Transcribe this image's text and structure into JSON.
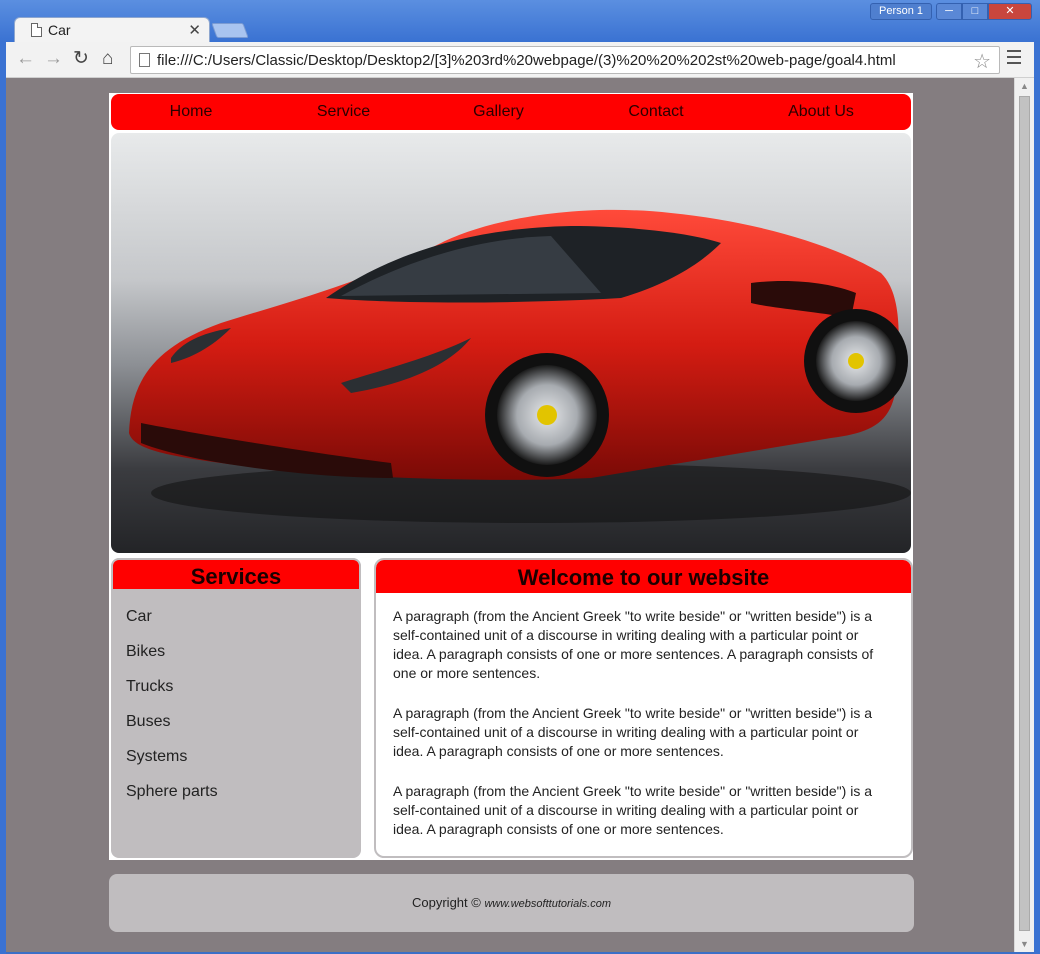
{
  "browser": {
    "tab_title": "Car",
    "tab_close": "✕",
    "profile": "Person 1",
    "url": "file:///C:/Users/Classic/Desktop/Desktop2/[3]%203rd%20webpage/(3)%20%20%202st%20web-page/goal4.html"
  },
  "nav": {
    "items": [
      "Home",
      "Service",
      "Gallery",
      "Contact",
      "About Us"
    ]
  },
  "services": {
    "heading": "Services",
    "items": [
      "Car",
      "Bikes",
      "Trucks",
      "Buses",
      "Systems",
      "Sphere parts"
    ]
  },
  "welcome": {
    "heading": "Welcome to our website",
    "paragraphs": [
      "A paragraph (from the Ancient Greek \"to write beside\" or \"written beside\") is a self-contained unit of a discourse in writing dealing with a particular point or idea. A paragraph consists of one or more sentences. A paragraph consists of one or more sentences.",
      "A paragraph (from the Ancient Greek \"to write beside\" or \"written beside\") is a self-contained unit of a discourse in writing dealing with a particular point or idea. A paragraph consists of one or more sentences.",
      "A paragraph (from the Ancient Greek \"to write beside\" or \"written beside\") is a self-contained unit of a discourse in writing dealing with a particular point or idea. A paragraph consists of one or more sentences."
    ]
  },
  "footer": {
    "copyright": "Copyright ©",
    "site": "www.websofttutorials.com"
  },
  "colors": {
    "accent": "#ff0000",
    "panel": "#c0bdbf",
    "page_bg": "#847d80"
  }
}
